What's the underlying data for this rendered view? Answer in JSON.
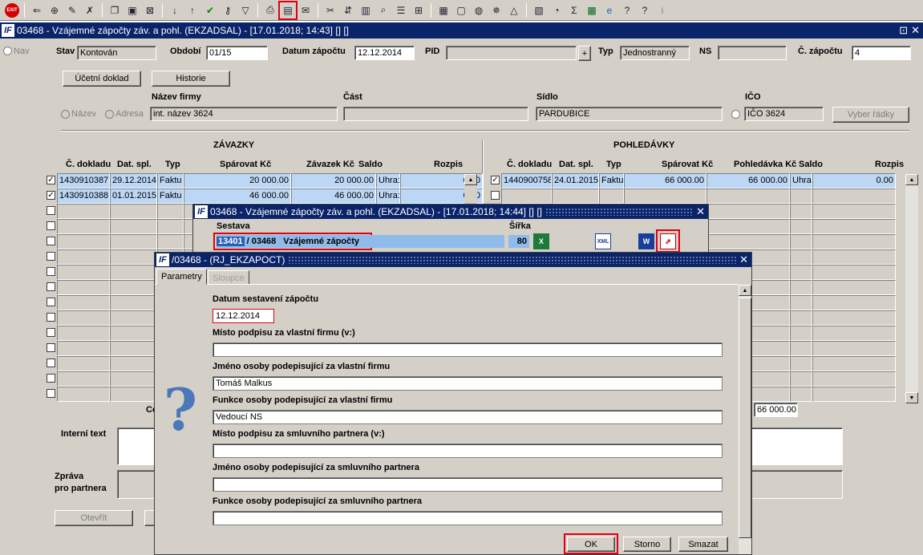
{
  "toolbar": {
    "exit_label": "EXIT"
  },
  "window": {
    "title": "03468 - Vzájemné zápočty záv. a pohl. (EKZADSAL) - [17.01.2018; 14:43]  [] []",
    "restore_glyph": "⊡",
    "close_glyph": "✕"
  },
  "nav_label": "Nav",
  "header": {
    "stav_label": "Stav",
    "stav_value": "Kontován",
    "obdobi_label": "Období",
    "obdobi_value": "01/15",
    "datum_label": "Datum zápočtu",
    "datum_value": "12.12.2014",
    "pid_label": "PID",
    "pid_value": "",
    "pid_btn": "+",
    "typ_label": "Typ",
    "typ_value": "Jednostranný",
    "ns_label": "NS",
    "ns_value": "",
    "czap_label": "Č. zápočtu",
    "czap_value": "4",
    "ucetni_btn": "Účetní doklad",
    "historie_btn": "Historie"
  },
  "firm": {
    "nazev_firmy_label": "Název firmy",
    "cast_label": "Část",
    "sidlo_label": "Sídlo",
    "ico_label": "IČO",
    "radio_nazev": "Název",
    "radio_adresa": "Adresa",
    "nazev_value": "int. název 3624",
    "cast_value": "",
    "sidlo_value": "PARDUBICE",
    "ico_value": "IČO 3624",
    "vyber_btn": "Vyber řádky"
  },
  "zavazky": {
    "title": "ZÁVAZKY",
    "cols": [
      "Č. dokladu",
      "Dat. spl.",
      "Typ",
      "Spárovat Kč",
      "Závazek Kč",
      "Saldo",
      "Rozpis"
    ],
    "rows": [
      [
        "1430910387",
        "29.12.2014",
        "Faktu",
        "20 000.00",
        "20 000.00",
        "Uhra:",
        "0.00"
      ],
      [
        "1430910388",
        "01.01.2015",
        "Faktu",
        "46 000.00",
        "46 000.00",
        "Uhra:",
        "0.00"
      ]
    ]
  },
  "pohledavky": {
    "title": "POHLEDÁVKY",
    "cols": [
      "Č. dokladu",
      "Dat. spl.",
      "Typ",
      "Spárovat Kč",
      "Pohledávka Kč",
      "Saldo",
      "Rozpis"
    ],
    "rows": [
      [
        "1440900758",
        "24.01.2015",
        "Faktu",
        "66 000.00",
        "66 000.00",
        "Uhra:",
        "0.00"
      ]
    ]
  },
  "totals": {
    "left_label": "Ce",
    "right_value": "66 000.00"
  },
  "bottom": {
    "interni_label": "Interní text",
    "zprava_label": "Zpráva\npro partnera",
    "otevrit_btn": "Otevřít"
  },
  "sestava_dialog": {
    "title": "03468 - Vzájemné zápočty záv. a pohl. (EKZADSAL) - [17.01.2018; 14:44]  [] []",
    "sestava_label": "Sestava",
    "sirka_label": "Šířka",
    "code": "13401",
    "code2": "/ 03468",
    "name": "Vzájemné zápočty",
    "sirka_value": "80",
    "icons": [
      "excel-icon",
      "xml-icon",
      "word-icon",
      "pdf-icon"
    ],
    "xml_text": "XML",
    "word_text": "W"
  },
  "param_dialog": {
    "title": "/03468 - (RJ_EKZAPOCT)",
    "tabs": [
      "Parametry",
      "Sloupce"
    ],
    "fields": [
      {
        "label": "Datum sestavení zápočtu",
        "value": "12.12.2014"
      },
      {
        "label": "Místo podpisu za vlastní firmu (v:)",
        "value": ""
      },
      {
        "label": "Jméno osoby podepisující za vlastní firmu",
        "value": "Tomáš Malkus"
      },
      {
        "label": "Funkce osoby podepisující za vlastní firmu",
        "value": "Vedoucí NS"
      },
      {
        "label": "Místo podpisu za smluvního partnera (v:)",
        "value": ""
      },
      {
        "label": "Jméno osoby podepisující za smluvního partnera",
        "value": ""
      },
      {
        "label": "Funkce osoby podepisující za smluvního partnera",
        "value": ""
      }
    ],
    "ok_btn": "OK",
    "storno_btn": "Storno",
    "smazat_btn": "Smazat"
  },
  "colors": {
    "title_bar": "#0a246a",
    "highlight": "#e00010",
    "selected_row": "#bcd7f6",
    "face": "#d4d0c8"
  }
}
